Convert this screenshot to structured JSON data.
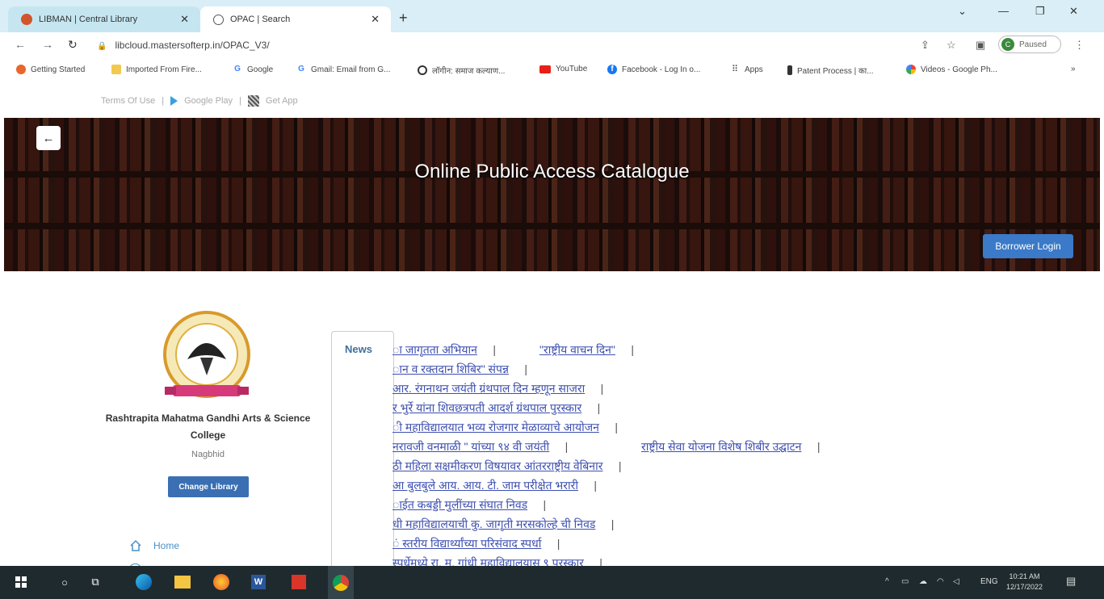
{
  "browser": {
    "tabs": [
      {
        "label": "LIBMAN | Central Library",
        "active": false
      },
      {
        "label": "OPAC | Search",
        "active": true
      }
    ],
    "url": "libcloud.mastersofterp.in/OPAC_V3/",
    "profile_status": "Paused",
    "profile_initial": "C",
    "bookmarks": [
      {
        "label": "Getting Started",
        "icon": "firefox-icon"
      },
      {
        "label": "Imported From Fire...",
        "icon": "folder-icon"
      },
      {
        "label": "Google",
        "icon": "google-icon"
      },
      {
        "label": "Gmail: Email from G...",
        "icon": "google-icon"
      },
      {
        "label": "लॉगीन: समाज कल्याण...",
        "icon": "chrome-icon"
      },
      {
        "label": "YouTube",
        "icon": "youtube-icon"
      },
      {
        "label": "Facebook - Log In o...",
        "icon": "facebook-icon"
      },
      {
        "label": "Apps",
        "icon": "apps-grid-icon"
      },
      {
        "label": "Patent Process | का...",
        "icon": "patent-icon"
      },
      {
        "label": "Videos - Google Ph...",
        "icon": "pinwheel-icon"
      }
    ],
    "more_bookmarks": "»"
  },
  "top_links": {
    "terms": "Terms Of Use",
    "google_play": "Google Play",
    "get_app": "Get App"
  },
  "banner": {
    "title": "Online Public Access Catalogue",
    "login": "Borrower Login"
  },
  "sidebar": {
    "college_name": "Rashtrapita Mahatma Gandhi Arts & Science College",
    "location": "Nagbhid",
    "change_library": "Change Library",
    "menu": [
      {
        "label": "Home",
        "icon": "home-icon"
      }
    ]
  },
  "news": {
    "label": "News",
    "lines": [
      [
        "ा जागृतता अभियान",
        "\"राष्ट्रीय वाचन दिन\""
      ],
      [
        "ान व रक्तदान शिबिर\" संपन्न"
      ],
      [
        "आर. रंगनाथन जयंती ग्रंथपाल दिन म्हणून साजरा"
      ],
      [
        "र भुर्रे यांना शिवछत्रपती आदर्श ग्रंथपाल पुरस्कार"
      ],
      [
        "ी महाविद्यालयात भव्य रोजगार मेळाव्याचे आयोजन"
      ],
      [
        "नरावजी वनमाळी \" यांच्या ९४ वी जयंती",
        "राष्ट्रीय सेवा योजना विशेष शिबीर उद्घाटन"
      ],
      [
        "ठी महिला सक्षमीकरण विषयावर आंतरराष्ट्रीय वेबिनार"
      ],
      [
        "आ बुलबुले आय. आय. टी. जाम परीक्षेत भरारी"
      ],
      [
        "ाईत कबड्डी मुलींच्या संघात निवड"
      ],
      [
        "धी महाविद्यालयाची कु. जागृती मरसकोल्हे ची निवड"
      ],
      [
        "ं स्तरीय विद्यार्थ्यांच्या परिसंवाद स्पर्धा"
      ],
      [
        "स्पर्धेमध्ये रा. म. गांधी महाविद्यालयास ९ पुरस्कार"
      ]
    ]
  },
  "taskbar": {
    "language": "ENG",
    "time": "10:21 AM",
    "date": "12/17/2022"
  }
}
